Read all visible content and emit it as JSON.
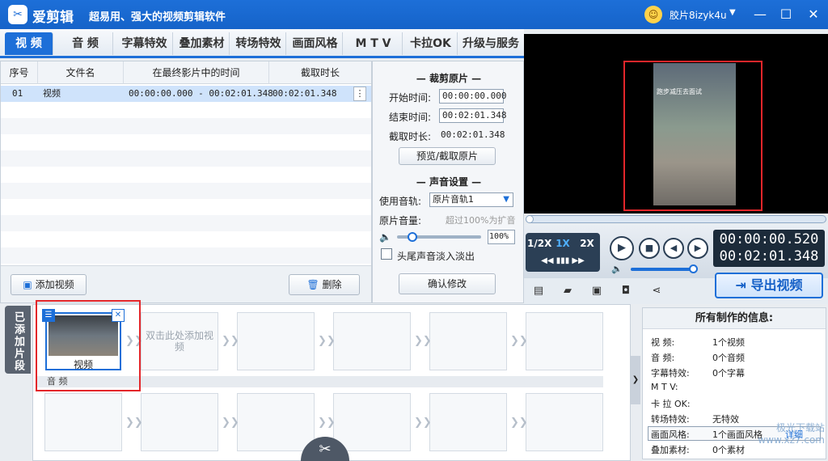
{
  "app": {
    "name": "爱剪辑",
    "slogan": "超易用、强大的视频剪辑软件",
    "username": "胶片8izyk4u"
  },
  "tabs": [
    "视 频",
    "音 频",
    "字幕特效",
    "叠加素材",
    "转场特效",
    "画面风格",
    "M T V",
    "卡拉OK",
    "升级与服务"
  ],
  "table": {
    "headers": [
      "序号",
      "文件名",
      "在最终影片中的时间",
      "截取时长"
    ],
    "rows": [
      {
        "index": "01",
        "name": "视频",
        "range": "00:00:00.000 - 00:02:01.348",
        "duration": "00:02:01.348"
      }
    ],
    "add_button": "添加视频",
    "delete_button": "删除"
  },
  "trim": {
    "title": "裁剪原片",
    "start_label": "开始时间:",
    "start_value": "00:00:00.000",
    "end_label": "结束时间:",
    "end_value": "00:02:01.348",
    "dur_label": "截取时长:",
    "dur_value": "00:02:01.348",
    "preview_button": "预览/截取原片"
  },
  "sound": {
    "title": "声音设置",
    "track_label": "使用音轨:",
    "track_value": "原片音轨1",
    "volume_label": "原片音量:",
    "volume_hint": "超过100%为扩音",
    "volume_value": "100%",
    "fade_label": "头尾声音淡入淡出",
    "confirm_button": "确认修改"
  },
  "player": {
    "speeds": [
      "1/2X",
      "1X",
      "2X"
    ],
    "current_time": "00:00:00.520",
    "total_time": "00:02:01.348",
    "overlay_text": "跑步减压去面试",
    "export_button": "导出视频"
  },
  "bottom": {
    "added_label": "已添加片段",
    "clip_label": "视频",
    "hint": "双击此处添加视频",
    "audio_label": "音 频"
  },
  "info": {
    "title": "所有制作的信息:",
    "rows": [
      {
        "k": "视    频:",
        "v": "1个视频"
      },
      {
        "k": "音    频:",
        "v": "0个音频"
      },
      {
        "k": "字幕特效:",
        "v": "0个字幕"
      },
      {
        "k": "M  T  V:",
        "v": ""
      },
      {
        "k": "卡 拉 OK:",
        "v": ""
      },
      {
        "k": "转场特效:",
        "v": "无特效"
      },
      {
        "k": "画面风格:",
        "v": "1个画面风格"
      },
      {
        "k": "叠加素材:",
        "v": "0个素材"
      }
    ],
    "detail_link": "详细"
  },
  "watermark": "极光下载站 www.xz7.com",
  "colors": {
    "accent": "#1d6fd8",
    "highlight_box": "#e3262a"
  }
}
